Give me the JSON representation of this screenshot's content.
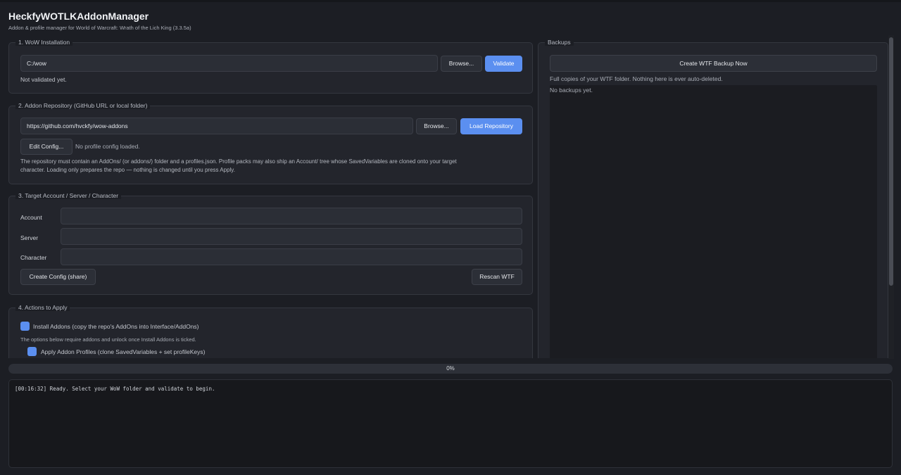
{
  "app": {
    "title": "HeckfyWOTLKAddonManager",
    "subtitle": "Addon & profile manager for World of Warcraft: Wrath of the Lich King (3.3.5a)"
  },
  "wow_install": {
    "title": "1. WoW Installation",
    "path_value": "C:/wow",
    "browse_label": "Browse...",
    "validate_label": "Validate",
    "status": "Not validated yet."
  },
  "repo": {
    "title": "2. Addon Repository (GitHub URL or local folder)",
    "url_value": "https://github.com/hvckfy/wow-addons",
    "browse_label": "Browse...",
    "load_label": "Load Repository",
    "edit_config_label": "Edit Config...",
    "config_status": "No profile config loaded.",
    "help_line1": "The repository must contain an AddOns/ (or addons/) folder and a profiles.json. Profile packs may also ship an Account/ tree whose SavedVariables are cloned onto your target",
    "help_line2": "character. Loading only prepares the repo — nothing is changed until you press Apply."
  },
  "target": {
    "title": "3. Target Account / Server / Character",
    "account_label": "Account",
    "server_label": "Server",
    "character_label": "Character",
    "account_value": "",
    "server_value": "",
    "character_value": "",
    "create_config_label": "Create Config (share)",
    "rescan_label": "Rescan WTF"
  },
  "actions": {
    "title": "4. Actions to Apply",
    "install_addons_label": "Install Addons (copy the repo's AddOns into Interface/AddOns)",
    "note": "The options below require addons and unlock once Install Addons is ticked.",
    "apply_profiles_label": "Apply Addon Profiles (clone SavedVariables + set profileKeys)"
  },
  "backups": {
    "title": "Backups",
    "create_label": "Create WTF Backup Now",
    "description": "Full copies of your WTF folder. Nothing here is ever auto-deleted.",
    "empty": "No backups yet."
  },
  "progress": {
    "percent": 0,
    "label": "0%"
  },
  "log": {
    "line1": "[00:16:32] Ready. Select your WoW folder and validate to begin."
  },
  "colors": {
    "accent": "#5b8ff0",
    "background": "#1c1e24",
    "panel": "#23252c"
  }
}
